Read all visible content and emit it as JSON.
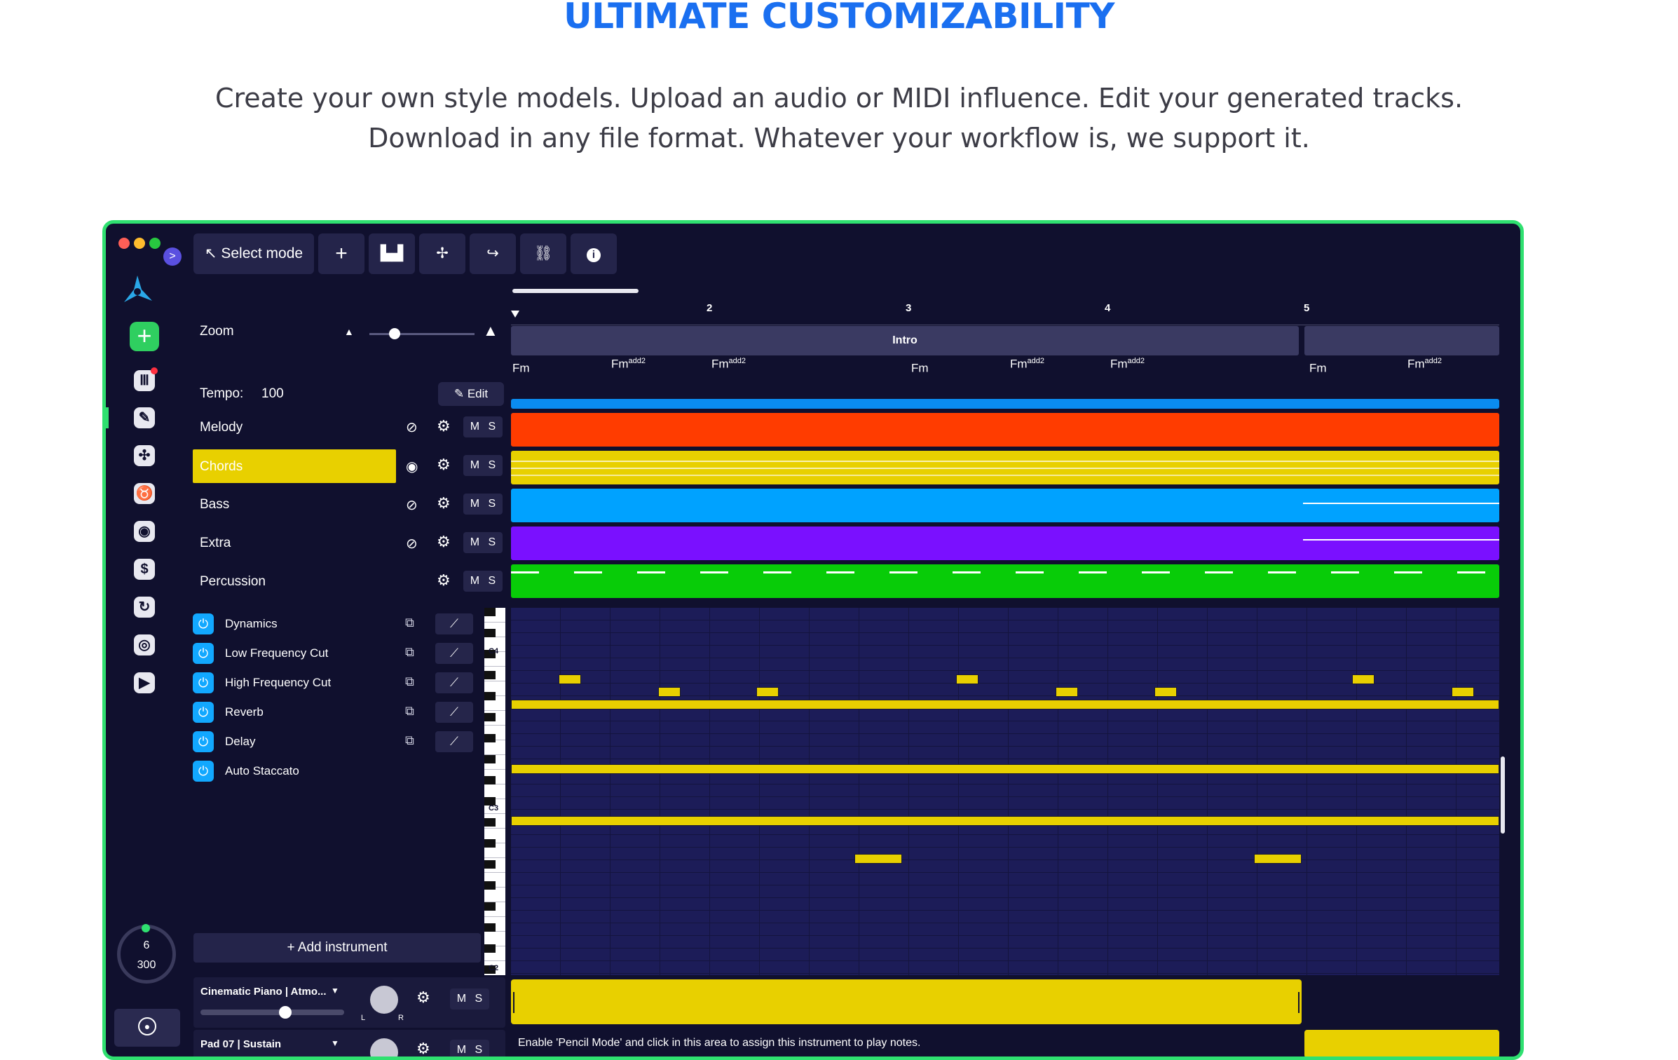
{
  "headline": "ULTIMATE CUSTOMIZABILITY",
  "subtitle": {
    "line1": "Create your own style models. Upload an audio or MIDI influence. Edit your generated tracks.",
    "line2": "Download in any file format. Whatever your workflow is, we support it."
  },
  "toolbar": {
    "select_mode": "Select mode",
    "icons": [
      "plus-icon",
      "equalizer-icon",
      "magic-wand-icon",
      "redo-arrow-icon",
      "link-icon",
      "info-icon"
    ]
  },
  "zoom_label": "Zoom",
  "tempo": {
    "label": "Tempo:",
    "value": "100",
    "edit_label": "Edit"
  },
  "tracks": [
    {
      "name": "Melody",
      "color": "#ff3c00",
      "selected": false,
      "visible": false
    },
    {
      "name": "Chords",
      "color": "#e8d000",
      "selected": true,
      "visible": true
    },
    {
      "name": "Bass",
      "color": "#00a2ff",
      "selected": false,
      "visible": false
    },
    {
      "name": "Extra",
      "color": "#7a10ff",
      "selected": false,
      "visible": false
    },
    {
      "name": "Percussion",
      "color": "#08cc08",
      "selected": false,
      "visible": true
    }
  ],
  "mute_solo": "M S",
  "effects": [
    "Dynamics",
    "Low Frequency Cut",
    "High Frequency Cut",
    "Reverb",
    "Delay",
    "Auto Staccato"
  ],
  "add_instrument": "Add instrument",
  "instruments": [
    {
      "name": "Cinematic Piano | Atmo...",
      "pan_left": "L",
      "pan_right": "R"
    },
    {
      "name": "Pad 07 | Sustain"
    }
  ],
  "timeline": {
    "bars": [
      "2",
      "3",
      "4",
      "5"
    ],
    "section": "Intro",
    "chords": [
      {
        "root": "Fm",
        "ext": ""
      },
      {
        "root": "Fm",
        "ext": "add2"
      },
      {
        "root": "Fm",
        "ext": "add2"
      },
      {
        "root": "Fm",
        "ext": ""
      },
      {
        "root": "Fm",
        "ext": "add2"
      },
      {
        "root": "Fm",
        "ext": "add2"
      },
      {
        "root": "Fm",
        "ext": ""
      },
      {
        "root": "Fm",
        "ext": "add2"
      }
    ]
  },
  "piano_labels": [
    "C4",
    "C3",
    "C2"
  ],
  "counter": {
    "top": "6",
    "bottom": "300"
  },
  "hint": "Enable 'Pencil Mode' and click in this area to assign this instrument to play notes.",
  "colors": {
    "accent_green": "#2fe070",
    "headline_blue": "#1a6ff0",
    "panel_bg": "#10102e",
    "blue_band": "#0a8cf0"
  }
}
